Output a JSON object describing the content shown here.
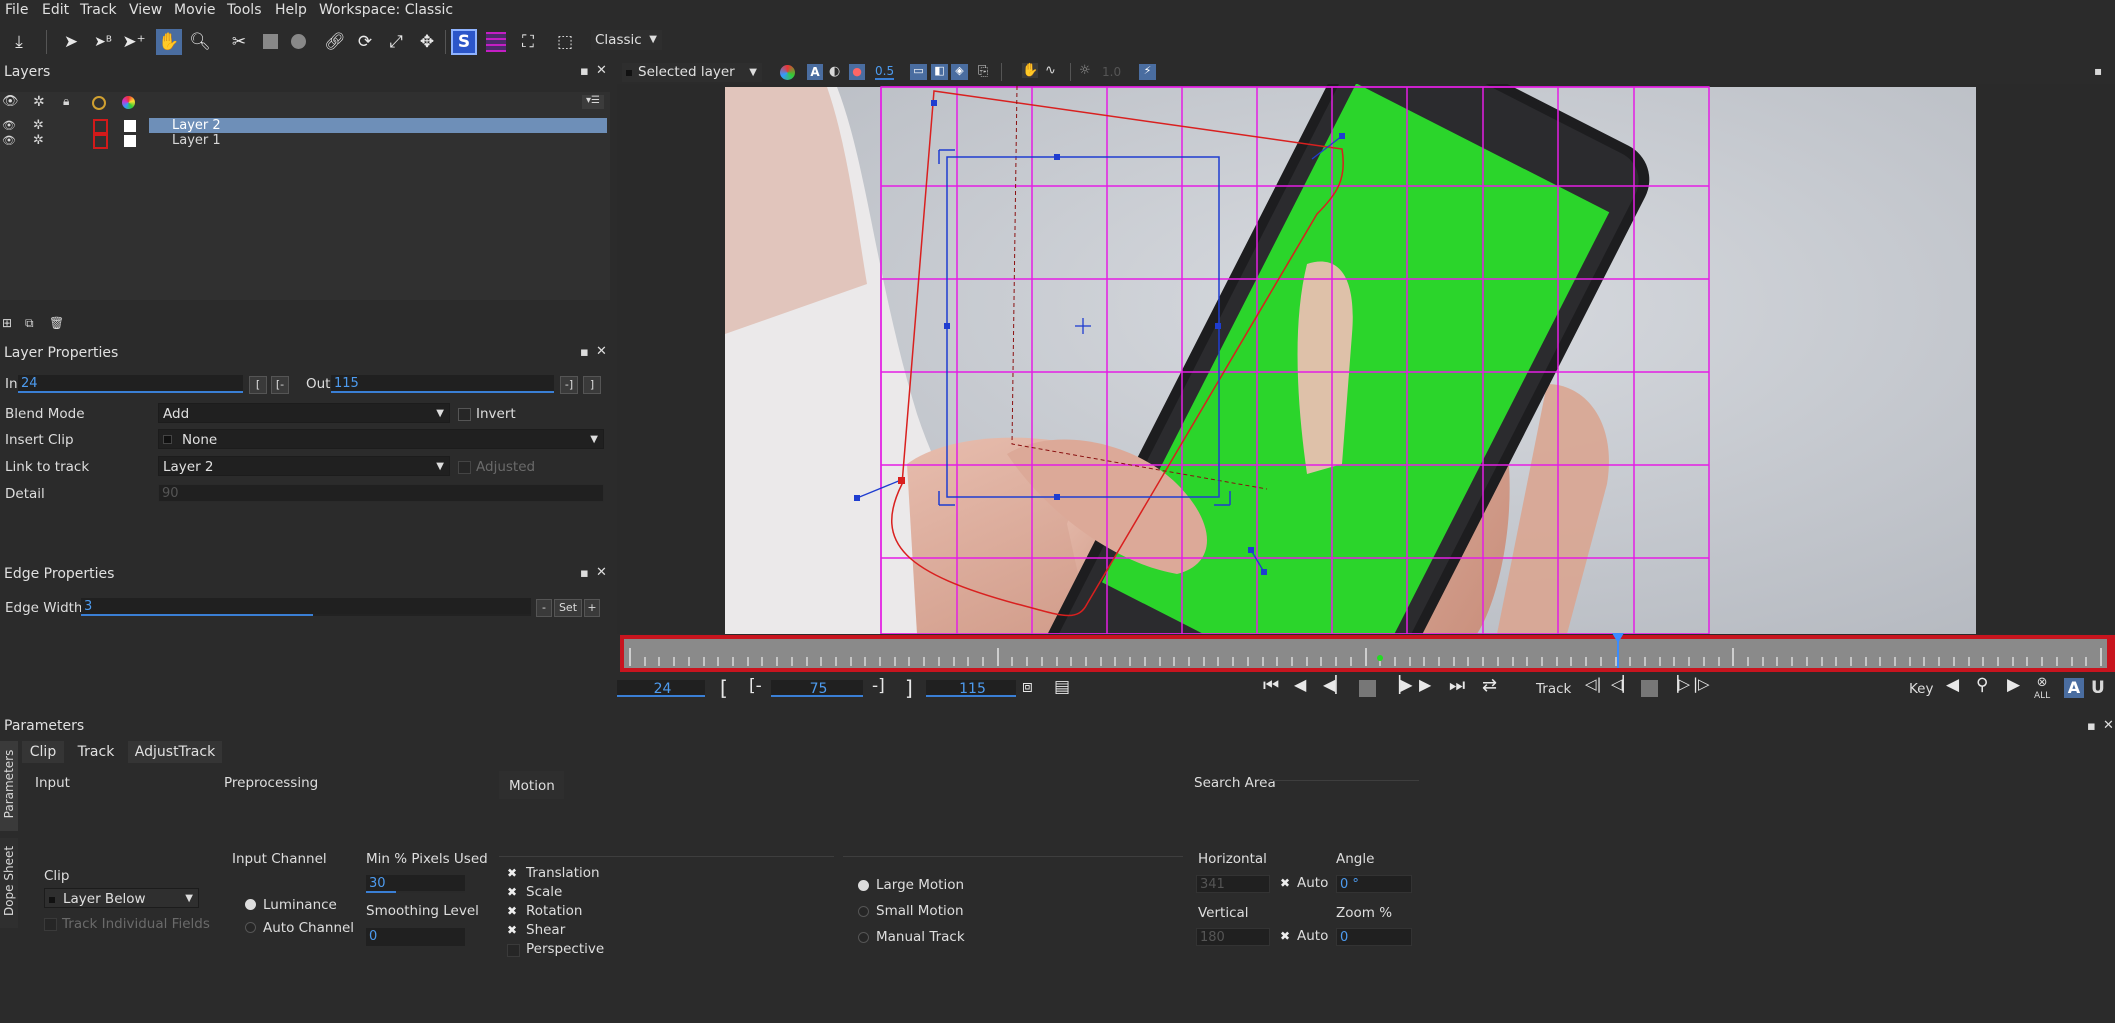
{
  "menu": [
    "File",
    "Edit",
    "Track",
    "View",
    "Movie",
    "Tools",
    "Help",
    "Workspace: Classic"
  ],
  "toolbar": {
    "workspace_select": "Classic"
  },
  "layers_panel": {
    "title": "Layers",
    "layers": [
      {
        "name": "Layer 2",
        "selected": true
      },
      {
        "name": "Layer 1",
        "selected": false
      }
    ]
  },
  "layer_properties": {
    "title": "Layer Properties",
    "in_label": "In",
    "in_value": "24",
    "out_label": "Out",
    "out_value": "115",
    "blend_mode_label": "Blend Mode",
    "blend_mode_value": "Add",
    "invert_label": "Invert",
    "insert_clip_label": "Insert Clip",
    "insert_clip_value": "None",
    "link_to_track_label": "Link to track",
    "link_to_track_value": "Layer 2",
    "adjusted_label": "Adjusted",
    "detail_label": "Detail",
    "detail_value": "90"
  },
  "edge_properties": {
    "title": "Edge Properties",
    "edge_width_label": "Edge Width",
    "edge_width_value": "3",
    "set_label": "Set"
  },
  "viewer_toolbar": {
    "view_select": "Selected layer",
    "opacity_value": "0.5",
    "exposure_value": "1.0"
  },
  "timeline": {
    "current_frame": "24",
    "middle_frame": "75",
    "end_frame": "115",
    "track_label": "Track",
    "key_label": "Key",
    "all_label": "ALL",
    "marker_fraction": 0.67
  },
  "parameters": {
    "title": "Parameters",
    "side_tabs": [
      "Parameters",
      "Dope Sheet"
    ],
    "tabs": [
      "Clip",
      "Track",
      "AdjustTrack"
    ],
    "sections": {
      "input": "Input",
      "preprocessing": "Preprocessing",
      "motion": "Motion",
      "search_area": "Search Area"
    },
    "clip_label": "Clip",
    "clip_value": "Layer Below",
    "track_individual_fields": "Track Individual Fields",
    "input_channel_label": "Input Channel",
    "luminance": "Luminance",
    "auto_channel": "Auto Channel",
    "min_pixels_label": "Min % Pixels Used",
    "min_pixels_value": "30",
    "smoothing_label": "Smoothing Level",
    "smoothing_value": "0",
    "motion_options": [
      {
        "label": "Translation",
        "checked": true
      },
      {
        "label": "Scale",
        "checked": true
      },
      {
        "label": "Rotation",
        "checked": true
      },
      {
        "label": "Shear",
        "checked": true
      },
      {
        "label": "Perspective",
        "checked": false
      }
    ],
    "motion_modes": [
      {
        "label": "Large Motion",
        "selected": true
      },
      {
        "label": "Small Motion",
        "selected": false
      },
      {
        "label": "Manual Track",
        "selected": false
      }
    ],
    "horizontal_label": "Horizontal",
    "horizontal_value": "341",
    "vertical_label": "Vertical",
    "vertical_value": "180",
    "auto_label": "Auto",
    "angle_label": "Angle",
    "angle_value": "0 °",
    "zoom_label": "Zoom %",
    "zoom_value": "0"
  },
  "colors": {
    "accent": "#4a7fc1",
    "selection": "#6e8fb8",
    "grid": "#e41ee4",
    "screen_green": "#2bd52b",
    "spline_blue": "#1f3dd0",
    "timeline_red": "#c8141e"
  }
}
